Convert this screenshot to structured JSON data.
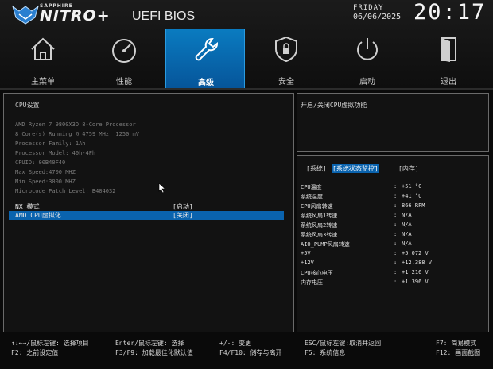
{
  "header": {
    "brand_small": "SAPPHIRE",
    "brand_big": "NITRO+",
    "bios_title": "UEFI BIOS",
    "day": "FRIDAY",
    "date": "06/06/2025",
    "time": "20:17"
  },
  "tabs": [
    {
      "label": "主菜单",
      "icon": "home-icon"
    },
    {
      "label": "性能",
      "icon": "speedometer-icon"
    },
    {
      "label": "高级",
      "icon": "wrench-icon",
      "active": true
    },
    {
      "label": "安全",
      "icon": "shield-lock-icon"
    },
    {
      "label": "启动",
      "icon": "power-icon"
    },
    {
      "label": "退出",
      "icon": "exit-door-icon"
    }
  ],
  "main": {
    "section_title": "CPU设置",
    "info_lines": [
      "AMD Ryzen 7 9800X3D 8-Core Processor",
      "8 Core(s) Running @ 4759 MHz  1250 mV",
      "Processor Family: 1Ah",
      "Processor Model: 40h-4Fh",
      "CPUID: 00B40F40",
      "Max Speed:4700 MHZ",
      "Min Speed:3000 MHZ",
      "Microcode Patch Level: B404032"
    ],
    "options": [
      {
        "label": "NX 模式",
        "value": "[启动]",
        "selected": false
      },
      {
        "label": "AMD CPU虚拟化",
        "value": "[关闭]",
        "selected": true
      }
    ]
  },
  "help": {
    "text": "开启/关闭CPU虚拟功能"
  },
  "monitor": {
    "tabs": [
      {
        "label": "[系统]",
        "active": false
      },
      {
        "label": "[系统状态监控]",
        "active": true
      },
      {
        "label": "[内存]",
        "active": false
      }
    ],
    "rows": [
      {
        "name": "CPU温度",
        "value": "+51 °C"
      },
      {
        "name": "系统温度",
        "value": "+41 °C"
      },
      {
        "name": "CPU风扇转速",
        "value": "866 RPM"
      },
      {
        "name": "系统风扇1转速",
        "value": "N/A"
      },
      {
        "name": "系统风扇2转速",
        "value": "N/A"
      },
      {
        "name": "系统风扇3转速",
        "value": "N/A"
      },
      {
        "name": "AIO_PUMP风扇转速",
        "value": "N/A"
      },
      {
        "name": "+5V",
        "value": "+5.072 V"
      },
      {
        "name": "+12V",
        "value": "+12.388 V"
      },
      {
        "name": "CPU核心电压",
        "value": "+1.216 V"
      },
      {
        "name": "内存电压",
        "value": "+1.396 V"
      }
    ],
    "colon": ":"
  },
  "footer": {
    "keys": [
      "↑↓←→/鼠标左键: 选择项目",
      "F2: 之前设定值",
      "Enter/鼠标左键: 选择",
      "F3/F9: 加载最佳化默认值",
      "+/-: 变更",
      "F4/F10: 储存与离开",
      "ESC/鼠标左键:取消并返回",
      "F5: 系统信息",
      "F7: 简易模式",
      "F12: 画面截图"
    ]
  },
  "colors": {
    "accent": "#0a63ae",
    "active_tab": "#0a7bc0"
  }
}
